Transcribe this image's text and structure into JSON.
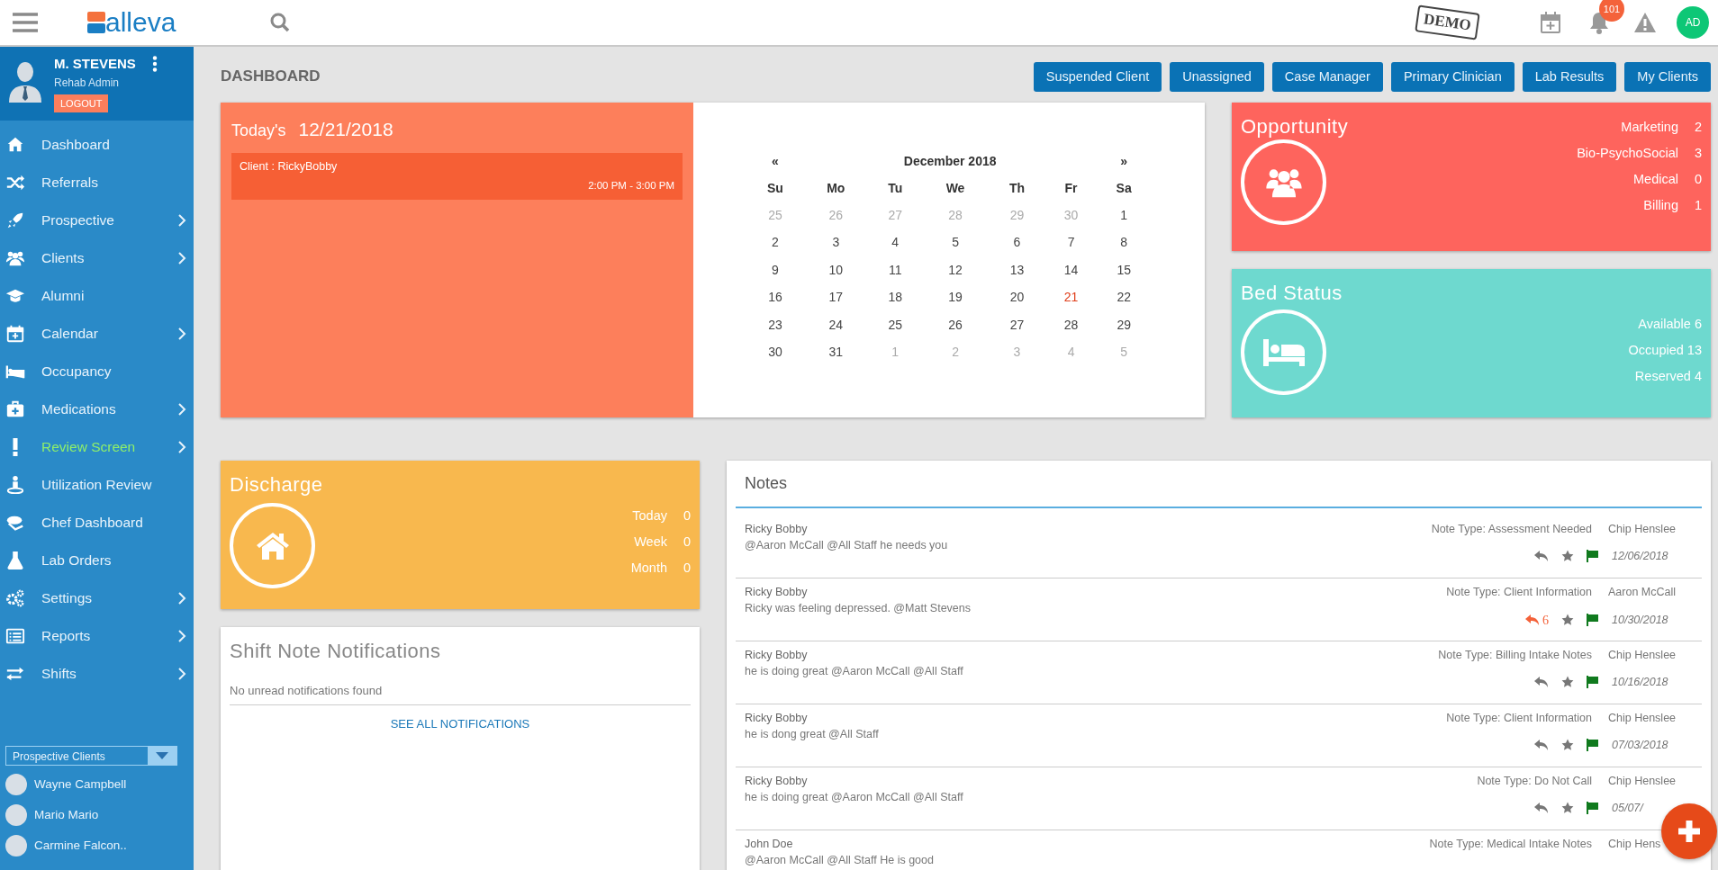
{
  "header": {
    "logo": "alleva",
    "demo_stamp": "DEMO",
    "notification_count": "101",
    "user_initials": "AD"
  },
  "profile": {
    "name": "M. STEVENS",
    "role": "Rehab Admin",
    "logout": "LOGOUT"
  },
  "nav": [
    {
      "label": "Dashboard",
      "has_submenu": false,
      "highlighted": false
    },
    {
      "label": "Referrals",
      "has_submenu": false,
      "highlighted": false
    },
    {
      "label": "Prospective",
      "has_submenu": true,
      "highlighted": false
    },
    {
      "label": "Clients",
      "has_submenu": true,
      "highlighted": false
    },
    {
      "label": "Alumni",
      "has_submenu": false,
      "highlighted": false
    },
    {
      "label": "Calendar",
      "has_submenu": true,
      "highlighted": false
    },
    {
      "label": "Occupancy",
      "has_submenu": false,
      "highlighted": false
    },
    {
      "label": "Medications",
      "has_submenu": true,
      "highlighted": false
    },
    {
      "label": "Review Screen",
      "has_submenu": true,
      "highlighted": true
    },
    {
      "label": "Utilization Review",
      "has_submenu": false,
      "highlighted": false
    },
    {
      "label": "Chef Dashboard",
      "has_submenu": false,
      "highlighted": false
    },
    {
      "label": "Lab Orders",
      "has_submenu": false,
      "highlighted": false
    },
    {
      "label": "Settings",
      "has_submenu": true,
      "highlighted": false
    },
    {
      "label": "Reports",
      "has_submenu": true,
      "highlighted": false
    },
    {
      "label": "Shifts",
      "has_submenu": true,
      "highlighted": false
    }
  ],
  "client_filter": {
    "value": "Prospective Clients"
  },
  "recent_clients": [
    {
      "name": "Wayne Campbell"
    },
    {
      "name": "Mario Mario"
    },
    {
      "name": "Carmine Falcon.."
    }
  ],
  "page_title": "DASHBOARD",
  "filter_buttons": [
    "Suspended Client",
    "Unassigned",
    "Case Manager",
    "Primary Clinician",
    "Lab Results",
    "My Clients"
  ],
  "today": {
    "label": "Today's",
    "date": "12/21/2018",
    "appointments": [
      {
        "client": "Client : RickyBobby",
        "time": "2:00 PM - 3:00 PM"
      }
    ]
  },
  "calendar": {
    "prev": "«",
    "month": "December 2018",
    "next": "»",
    "weekdays": [
      "Su",
      "Mo",
      "Tu",
      "We",
      "Th",
      "Fr",
      "Sa"
    ],
    "weeks": [
      [
        {
          "day": "25",
          "muted": true,
          "selected": false
        },
        {
          "day": "26",
          "muted": true,
          "selected": false
        },
        {
          "day": "27",
          "muted": true,
          "selected": false
        },
        {
          "day": "28",
          "muted": true,
          "selected": false
        },
        {
          "day": "29",
          "muted": true,
          "selected": false
        },
        {
          "day": "30",
          "muted": true,
          "selected": false
        },
        {
          "day": "1",
          "muted": false,
          "selected": false
        }
      ],
      [
        {
          "day": "2",
          "muted": false,
          "selected": false
        },
        {
          "day": "3",
          "muted": false,
          "selected": false
        },
        {
          "day": "4",
          "muted": false,
          "selected": false
        },
        {
          "day": "5",
          "muted": false,
          "selected": false
        },
        {
          "day": "6",
          "muted": false,
          "selected": false
        },
        {
          "day": "7",
          "muted": false,
          "selected": false
        },
        {
          "day": "8",
          "muted": false,
          "selected": false
        }
      ],
      [
        {
          "day": "9",
          "muted": false,
          "selected": false
        },
        {
          "day": "10",
          "muted": false,
          "selected": false
        },
        {
          "day": "11",
          "muted": false,
          "selected": false
        },
        {
          "day": "12",
          "muted": false,
          "selected": false
        },
        {
          "day": "13",
          "muted": false,
          "selected": false
        },
        {
          "day": "14",
          "muted": false,
          "selected": false
        },
        {
          "day": "15",
          "muted": false,
          "selected": false
        }
      ],
      [
        {
          "day": "16",
          "muted": false,
          "selected": false
        },
        {
          "day": "17",
          "muted": false,
          "selected": false
        },
        {
          "day": "18",
          "muted": false,
          "selected": false
        },
        {
          "day": "19",
          "muted": false,
          "selected": false
        },
        {
          "day": "20",
          "muted": false,
          "selected": false
        },
        {
          "day": "21",
          "muted": false,
          "selected": true
        },
        {
          "day": "22",
          "muted": false,
          "selected": false
        }
      ],
      [
        {
          "day": "23",
          "muted": false,
          "selected": false
        },
        {
          "day": "24",
          "muted": false,
          "selected": false
        },
        {
          "day": "25",
          "muted": false,
          "selected": false
        },
        {
          "day": "26",
          "muted": false,
          "selected": false
        },
        {
          "day": "27",
          "muted": false,
          "selected": false
        },
        {
          "day": "28",
          "muted": false,
          "selected": false
        },
        {
          "day": "29",
          "muted": false,
          "selected": false
        }
      ],
      [
        {
          "day": "30",
          "muted": false,
          "selected": false
        },
        {
          "day": "31",
          "muted": false,
          "selected": false
        },
        {
          "day": "1",
          "muted": true,
          "selected": false
        },
        {
          "day": "2",
          "muted": true,
          "selected": false
        },
        {
          "day": "3",
          "muted": true,
          "selected": false
        },
        {
          "day": "4",
          "muted": true,
          "selected": false
        },
        {
          "day": "5",
          "muted": true,
          "selected": false
        }
      ]
    ]
  },
  "opportunity": {
    "title": "Opportunity",
    "stats": [
      {
        "label": "Marketing",
        "value": "2"
      },
      {
        "label": "Bio-PsychoSocial",
        "value": "3"
      },
      {
        "label": "Medical",
        "value": "0"
      },
      {
        "label": "Billing",
        "value": "1"
      }
    ]
  },
  "bed_status": {
    "title": "Bed Status",
    "stats": [
      {
        "text": "Available 6"
      },
      {
        "text": "Occupied 13"
      },
      {
        "text": "Reserved 4"
      }
    ]
  },
  "discharge": {
    "title": "Discharge",
    "stats": [
      {
        "label": "Today",
        "value": "0"
      },
      {
        "label": "Week",
        "value": "0"
      },
      {
        "label": "Month",
        "value": "0"
      }
    ]
  },
  "shift_notes": {
    "title": "Shift Note Notifications",
    "empty_message": "No unread notifications found",
    "link": "SEE ALL NOTIFICATIONS"
  },
  "notes": {
    "title": "Notes",
    "items": [
      {
        "client": "Ricky Bobby",
        "text": "@Aaron McCall @All Staff he needs you",
        "type": "Note Type: Assessment Needed",
        "author": "Chip Henslee",
        "has_replies": false,
        "date": "12/06/2018"
      },
      {
        "client": "Ricky Bobby",
        "text": "Ricky was feeling depressed. @Matt Stevens",
        "type": "Note Type: Client Information",
        "author": "Aaron McCall",
        "has_replies": true,
        "reply_count": "6",
        "date": "10/30/2018"
      },
      {
        "client": "Ricky Bobby",
        "text": "he is doing great @Aaron McCall @All Staff",
        "type": "Note Type: Billing Intake Notes",
        "author": "Chip Henslee",
        "has_replies": false,
        "date": "10/16/2018"
      },
      {
        "client": "Ricky Bobby",
        "text": "he is dong great @All Staff",
        "type": "Note Type: Client Information",
        "author": "Chip Henslee",
        "has_replies": false,
        "date": "07/03/2018"
      },
      {
        "client": "Ricky Bobby",
        "text": "he is doing great @Aaron McCall @All Staff",
        "type": "Note Type: Do Not Call",
        "author": "Chip Henslee",
        "has_replies": false,
        "date": "05/07/"
      },
      {
        "client": "John Doe",
        "text": "@Aaron McCall @All Staff He is good",
        "type": "Note Type: Medical Intake Notes",
        "author": "Chip Hens"
      }
    ]
  }
}
